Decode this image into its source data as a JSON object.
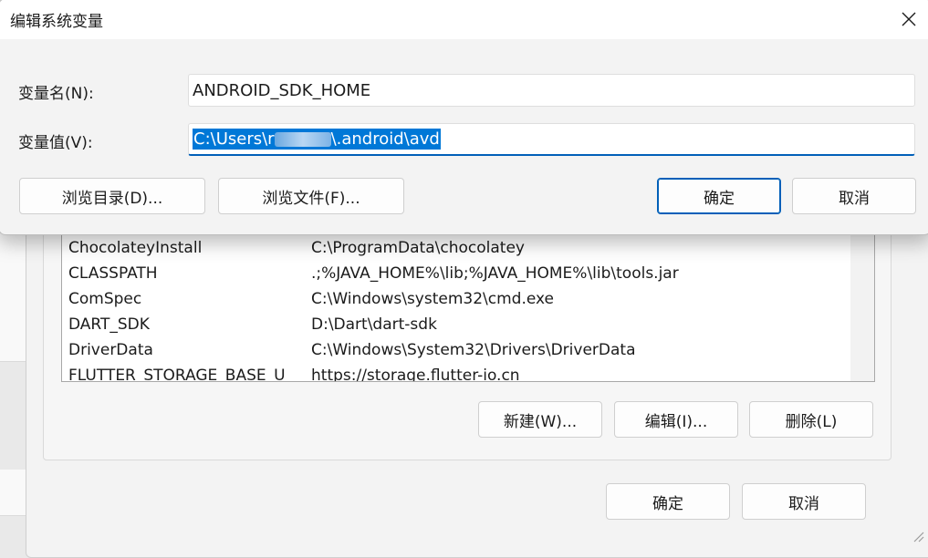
{
  "dialog": {
    "title": "编辑系统变量",
    "name_label": "变量名(N):",
    "name_value": "ANDROID_SDK_HOME",
    "value_label": "变量值(V):",
    "value_prefix": "C:\\Users\\r",
    "value_suffix": "\\.android\\avd",
    "browse_dir_label": "浏览目录(D)...",
    "browse_file_label": "浏览文件(F)...",
    "ok_label": "确定",
    "cancel_label": "取消"
  },
  "system_vars": {
    "rows": [
      {
        "name": "ChocolateyInstall",
        "value": "C:\\ProgramData\\chocolatey"
      },
      {
        "name": "CLASSPATH",
        "value": ".;%JAVA_HOME%\\lib;%JAVA_HOME%\\lib\\tools.jar"
      },
      {
        "name": "ComSpec",
        "value": "C:\\Windows\\system32\\cmd.exe"
      },
      {
        "name": "DART_SDK",
        "value": "D:\\Dart\\dart-sdk"
      },
      {
        "name": "DriverData",
        "value": "C:\\Windows\\System32\\Drivers\\DriverData"
      },
      {
        "name": "FLUTTER_STORAGE_BASE_U",
        "value": "https://storage.flutter-io.cn"
      }
    ],
    "new_label": "新建(W)...",
    "edit_label": "编辑(I)...",
    "delete_label": "删除(L)"
  },
  "back_window": {
    "ok_label": "确定",
    "cancel_label": "取消"
  }
}
